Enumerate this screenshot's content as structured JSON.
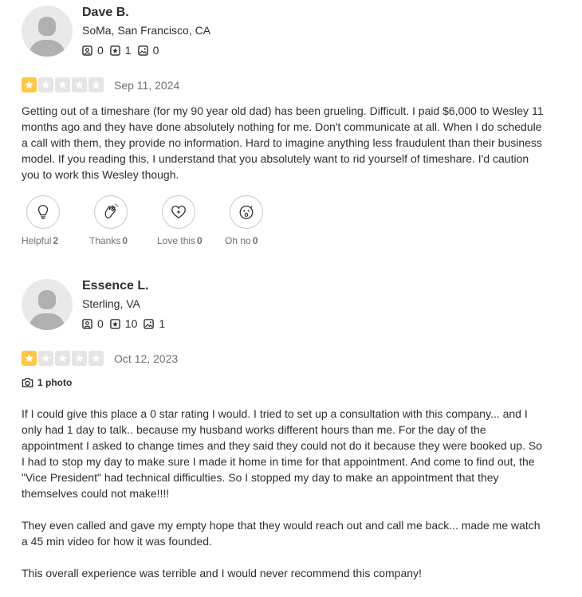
{
  "reviews": [
    {
      "user": {
        "name": "Dave B.",
        "location": "SoMa, San Francisco, CA",
        "friends": "0",
        "reviews": "1",
        "photos": "0"
      },
      "rating": 1,
      "date": "Sep 11, 2024",
      "text": [
        "Getting out of a timeshare (for my 90 year old dad) has been grueling. Difficult. I paid $6,000 to Wesley 11 months ago and they have done absolutely nothing for me. Don't communicate at all. When I do schedule a call with them, they provide no information. Hard to imagine anything less fraudulent than their business model. If you reading this, I understand that you absolutely want to rid yourself of timeshare. I'd caution you to work this Wesley though."
      ],
      "reactions": [
        {
          "label": "Helpful",
          "count": "2",
          "icon": "lightbulb-icon"
        },
        {
          "label": "Thanks",
          "count": "0",
          "icon": "clapping-hands-icon"
        },
        {
          "label": "Love this",
          "count": "0",
          "icon": "heart-sparkle-icon"
        },
        {
          "label": "Oh no",
          "count": "0",
          "icon": "shocked-face-icon"
        }
      ]
    },
    {
      "user": {
        "name": "Essence L.",
        "location": "Sterling, VA",
        "friends": "0",
        "reviews": "10",
        "photos": "1"
      },
      "rating": 1,
      "date": "Oct 12, 2023",
      "photo_link": "1 photo",
      "text": [
        "If I could give this place a 0 star rating I would. I tried to set up a consultation with this company... and I only had 1 day to talk.. because my husband works different hours than me. For the day of the appointment I asked to change times and they said they could not do it because they were booked up. So I had to stop my day to make sure I made it home in time for that appointment. And come to find out, the \"Vice President\" had technical difficulties. So I stopped my day to make an appointment that they themselves could not make!!!!",
        "They even called and gave my empty hope that they would reach out and call me back... made me watch a 45 min video for how it was founded.",
        "This overall experience was terrible and I would never recommend this company!"
      ]
    }
  ],
  "colors": {
    "star_filled": "#fec842",
    "star_empty": "#e5e5e5",
    "text": "#2d2e2f",
    "muted": "#6e7072"
  }
}
